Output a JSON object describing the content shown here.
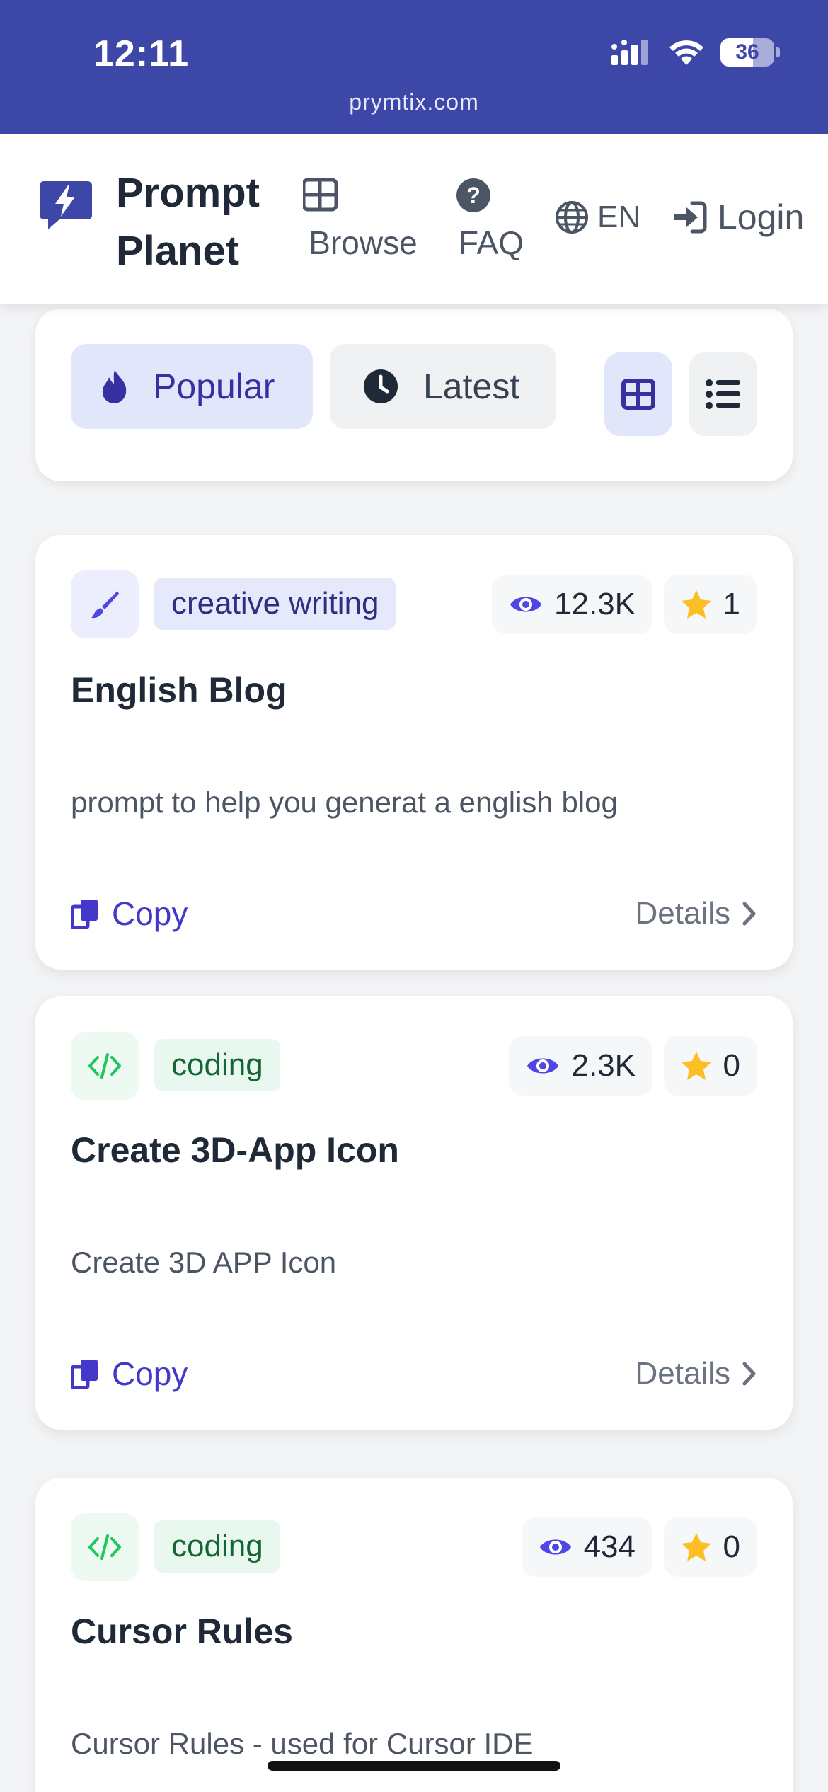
{
  "status_bar": {
    "time": "12:11",
    "battery": "36",
    "url": "prymtix.com"
  },
  "header": {
    "brand_line1": "Prompt",
    "brand_line2": "Planet",
    "nav": {
      "browse": "Browse",
      "faq": "FAQ",
      "language": "EN",
      "login": "Login"
    }
  },
  "filters": {
    "popular": "Popular",
    "latest": "Latest",
    "active_sort": "Popular",
    "active_view": "grid"
  },
  "colors": {
    "brand": "#3d47a8",
    "accent": "#4338ca",
    "star": "#fbbf24",
    "eye": "#4f46e5",
    "coding": "#22c55e"
  },
  "prompts": [
    {
      "icon": "brush-icon",
      "category": "creative writing",
      "views": "12.3K",
      "stars": "1",
      "title": "English Blog",
      "description": "prompt to help you generat a english blog",
      "copy": "Copy",
      "details": "Details"
    },
    {
      "icon": "code-icon",
      "category": "coding",
      "views": "2.3K",
      "stars": "0",
      "title": "Create 3D-App Icon",
      "description": "Create 3D APP Icon",
      "copy": "Copy",
      "details": "Details"
    },
    {
      "icon": "code-icon",
      "category": "coding",
      "views": "434",
      "stars": "0",
      "title": "Cursor Rules",
      "description": "Cursor Rules - used for Cursor IDE"
    }
  ]
}
